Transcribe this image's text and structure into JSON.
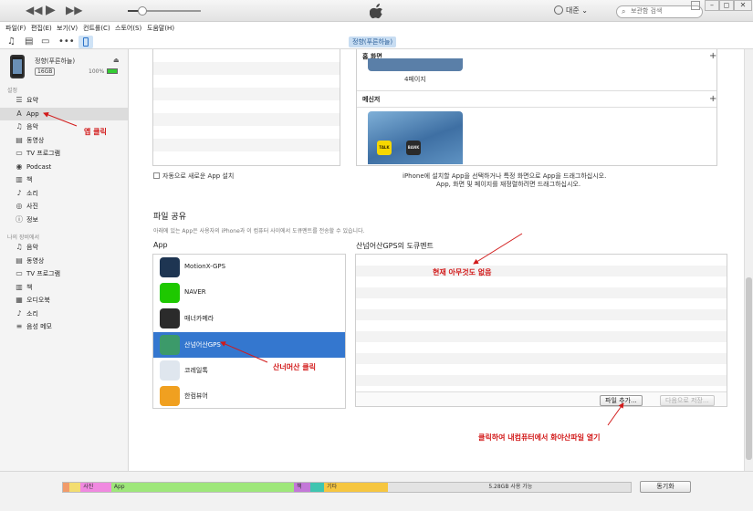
{
  "menu": [
    "파일(F)",
    "편집(E)",
    "보기(V)",
    "컨트롤(C)",
    "스토어(S)",
    "도움말(H)"
  ],
  "player": {
    "volume_level": 0.2
  },
  "user": {
    "name": "대준"
  },
  "search": {
    "placeholder": "보관함 검색"
  },
  "device": {
    "tab_label": "정향(푸른하늘)",
    "name": "정향(푸른하늘)",
    "capacity": "16GB",
    "battery": "100%"
  },
  "sidebar": {
    "settings_header": "설정",
    "settings_items": [
      {
        "label": "요약",
        "icon": "summary-icon"
      },
      {
        "label": "App",
        "icon": "app-store-icon"
      },
      {
        "label": "음악",
        "icon": "music-icon"
      },
      {
        "label": "동영상",
        "icon": "movie-icon"
      },
      {
        "label": "TV 프로그램",
        "icon": "tv-icon"
      },
      {
        "label": "Podcast",
        "icon": "podcast-icon"
      },
      {
        "label": "책",
        "icon": "book-icon"
      },
      {
        "label": "소리",
        "icon": "bell-icon"
      },
      {
        "label": "사진",
        "icon": "camera-icon"
      },
      {
        "label": "정보",
        "icon": "info-icon"
      }
    ],
    "ondevice_header": "나의 장비에서",
    "ondevice_items": [
      {
        "label": "음악",
        "icon": "music-icon"
      },
      {
        "label": "동영상",
        "icon": "movie-icon"
      },
      {
        "label": "TV 프로그램",
        "icon": "tv-icon"
      },
      {
        "label": "책",
        "icon": "book-icon"
      },
      {
        "label": "오디오북",
        "icon": "audiobook-icon"
      },
      {
        "label": "소리",
        "icon": "bell-icon"
      },
      {
        "label": "음성 메모",
        "icon": "voice-memo-icon"
      }
    ]
  },
  "apps_section": {
    "auto_install_label": "자동으로 새로운 App 설치",
    "home_screen_label": "홈 화면",
    "page_label": "4페이지",
    "messenger_label": "메신저",
    "kakao_talk": "TALK",
    "kakao_bank": "BANK",
    "instruction_line1": "iPhone에 설치할 App을 선택하거나 특정 화면으로 App을 드래그하십시오.",
    "instruction_line2": "App, 화면 및 페이지를 재정렬하려면 드래그하십시오."
  },
  "file_sharing": {
    "title": "파일 공유",
    "description": "아래에 있는 App은 사용자의 iPhone과 이 컴퓨터 사이에서 도큐멘트를 전송할 수 있습니다.",
    "app_column_label": "App",
    "docs_column_label": "산넘어산GPS의 도큐멘트",
    "apps": [
      {
        "name": "MotionX-GPS",
        "icon": "motionx-gps-icon",
        "color": "#1e3552"
      },
      {
        "name": "NAVER",
        "icon": "naver-icon",
        "color": "#1ec800"
      },
      {
        "name": "매너카메라",
        "icon": "manner-camera-icon",
        "color": "#2b2b2b"
      },
      {
        "name": "산넘어산GPS",
        "icon": "sanneomeosan-gps-icon",
        "color": "#3c9a6a"
      },
      {
        "name": "코레일톡",
        "icon": "korail-talk-icon",
        "color": "#dfe6ee"
      },
      {
        "name": "한컴뷰어",
        "icon": "hancom-viewer-icon",
        "color": "#f0a020"
      }
    ],
    "selected_app": "산넘어산GPS",
    "add_file_button": "파일 추가...",
    "save_to_button": "다음으로 저장..."
  },
  "annotations": {
    "app_click": "앱 클릭",
    "nothing_now": "현재 아무것도 없음",
    "sanneomeosan_click": "산너머산 클릭",
    "open_file": "클릭하여 내컴퓨터에서 화야산파일 열기"
  },
  "capacity_bar": {
    "segments": [
      {
        "label": "",
        "color": "#f19b6a",
        "fraction": 0.011
      },
      {
        "label": "",
        "color": "#f3dd70",
        "fraction": 0.02
      },
      {
        "label": "사진",
        "color": "#f089e0",
        "fraction": 0.054
      },
      {
        "label": "App",
        "color": "#9ee77a",
        "fraction": 0.322
      },
      {
        "label": "책",
        "color": "#c378d8",
        "fraction": 0.028
      },
      {
        "label": "",
        "color": "#3fc5b0",
        "fraction": 0.025
      },
      {
        "label": "기타",
        "color": "#f6c640",
        "fraction": 0.112
      },
      {
        "label": "5.28GB 사용 가능",
        "color": "#e3e3e3",
        "fraction": 0.428
      }
    ],
    "sync_button": "동기화"
  },
  "colors": {
    "accent": "#3477cf",
    "annotation": "#d21a1a"
  }
}
